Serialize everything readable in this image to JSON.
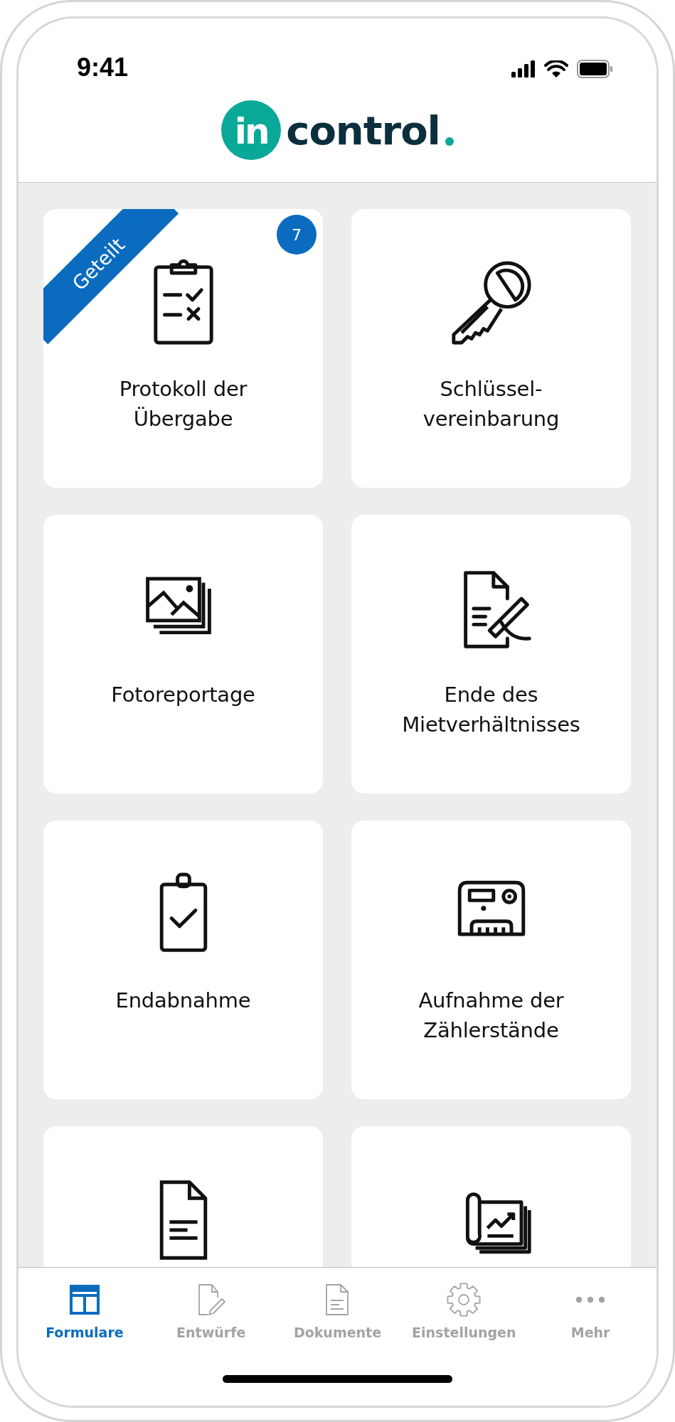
{
  "status_bar": {
    "time": "9:41"
  },
  "logo": {
    "mark_text": "in",
    "wordmark": "control"
  },
  "cards": [
    {
      "kind": "checklist",
      "label": "Protokoll der\nÜbergabe",
      "ribbon": "Geteilt",
      "badge": "7"
    },
    {
      "kind": "key",
      "label": "Schlüssel-\nvereinbarung"
    },
    {
      "kind": "photos",
      "label": "Fotoreportage"
    },
    {
      "kind": "signing",
      "label": "Ende des\nMietverhältnisses"
    },
    {
      "kind": "clipboard",
      "label": "Endabnahme"
    },
    {
      "kind": "meter",
      "label": "Aufnahme der\nZählerstände"
    },
    {
      "kind": "document"
    },
    {
      "kind": "plan"
    }
  ],
  "tabs": [
    {
      "kind": "forms",
      "label": "Formulare",
      "selected": true
    },
    {
      "kind": "drafts",
      "label": "Entwürfe",
      "selected": false
    },
    {
      "kind": "documents",
      "label": "Dokumente",
      "selected": false
    },
    {
      "kind": "settings",
      "label": "Einstellungen",
      "selected": false
    },
    {
      "kind": "more",
      "label": "Mehr",
      "selected": false
    }
  ]
}
